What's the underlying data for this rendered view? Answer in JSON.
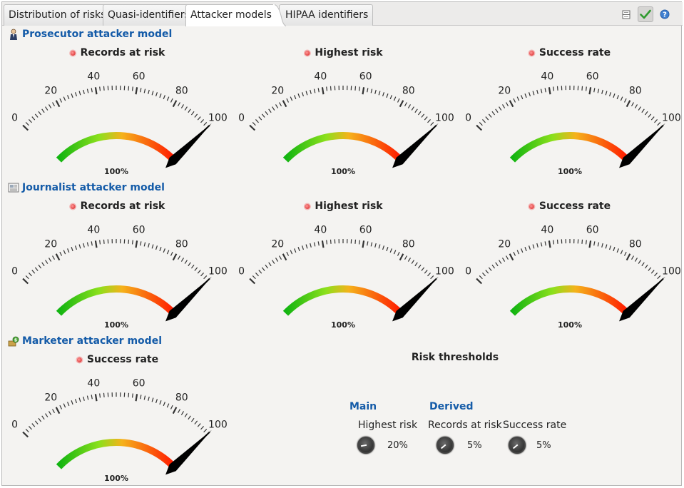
{
  "tabs": [
    {
      "label": "Distribution of risks",
      "active": false
    },
    {
      "label": "Quasi-identifiers",
      "active": false
    },
    {
      "label": "Attacker models",
      "active": true
    },
    {
      "label": "HIPAA identifiers",
      "active": false
    }
  ],
  "toolbar": {
    "buttons": [
      {
        "icon": "split-view-icon"
      },
      {
        "icon": "checkmark-icon",
        "pressed": true
      },
      {
        "icon": "help-icon"
      }
    ]
  },
  "gauge_scale": {
    "ticks": [
      "0",
      "20",
      "40",
      "60",
      "80",
      "100"
    ],
    "min": 0,
    "max": 100
  },
  "sections": [
    {
      "title": "Prosecutor attacker model",
      "icon": "prosecutor-icon",
      "gauges": [
        {
          "label": "Records at risk",
          "value": 100,
          "display": "100%"
        },
        {
          "label": "Highest risk",
          "value": 100,
          "display": "100%"
        },
        {
          "label": "Success rate",
          "value": 100,
          "display": "100%"
        }
      ]
    },
    {
      "title": "Journalist attacker model",
      "icon": "journalist-icon",
      "gauges": [
        {
          "label": "Records at risk",
          "value": 100,
          "display": "100%"
        },
        {
          "label": "Highest risk",
          "value": 100,
          "display": "100%"
        },
        {
          "label": "Success rate",
          "value": 100,
          "display": "100%"
        }
      ]
    },
    {
      "title": "Marketer attacker model",
      "icon": "marketer-icon",
      "gauges": [
        {
          "label": "Success rate",
          "value": 100,
          "display": "100%"
        }
      ]
    }
  ],
  "thresholds": {
    "title": "Risk thresholds",
    "main_label": "Main",
    "derived_label": "Derived",
    "items": [
      {
        "label": "Highest risk",
        "value": "20%"
      },
      {
        "label": "Records at risk",
        "value": "5%"
      },
      {
        "label": "Success rate",
        "value": "5%"
      }
    ]
  }
}
